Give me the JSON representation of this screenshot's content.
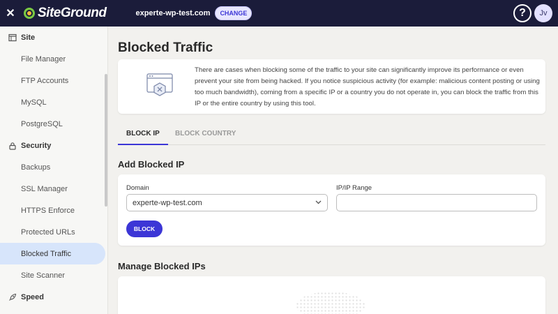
{
  "topbar": {
    "logo_text": "SiteGround",
    "site_name": "experte-wp-test.com",
    "change_label": "CHANGE",
    "help_label": "?",
    "avatar_initials": "Jv"
  },
  "sidebar": {
    "sections": [
      {
        "label": "Site",
        "icon": "site-icon",
        "items": [
          "File Manager",
          "FTP Accounts",
          "MySQL",
          "PostgreSQL"
        ]
      },
      {
        "label": "Security",
        "icon": "lock-icon",
        "items": [
          "Backups",
          "SSL Manager",
          "HTTPS Enforce",
          "Protected URLs",
          "Blocked Traffic",
          "Site Scanner"
        ]
      },
      {
        "label": "Speed",
        "icon": "rocket-icon",
        "items": []
      }
    ],
    "active_item": "Blocked Traffic"
  },
  "main": {
    "title": "Blocked Traffic",
    "info_text": "There are cases when blocking some of the traffic to your site can significantly improve its performance or even prevent your site from being hacked. If you notice suspicious activity (for example: malicious content posting or using too much bandwidth), coming from a specific IP or a country you do not operate in, you can block the traffic from this IP or the entire country by using this tool.",
    "tabs": [
      {
        "label": "BLOCK IP",
        "active": true
      },
      {
        "label": "BLOCK COUNTRY",
        "active": false
      }
    ],
    "add_section_title": "Add Blocked IP",
    "domain_label": "Domain",
    "domain_value": "experte-wp-test.com",
    "ip_label": "IP/IP Range",
    "ip_value": "",
    "block_button": "BLOCK",
    "manage_section_title": "Manage Blocked IPs"
  },
  "colors": {
    "topbar_bg": "#1b1c3a",
    "accent": "#3c36d6",
    "active_nav_bg": "#d7e5fb",
    "logo_green": "#7ac943"
  }
}
